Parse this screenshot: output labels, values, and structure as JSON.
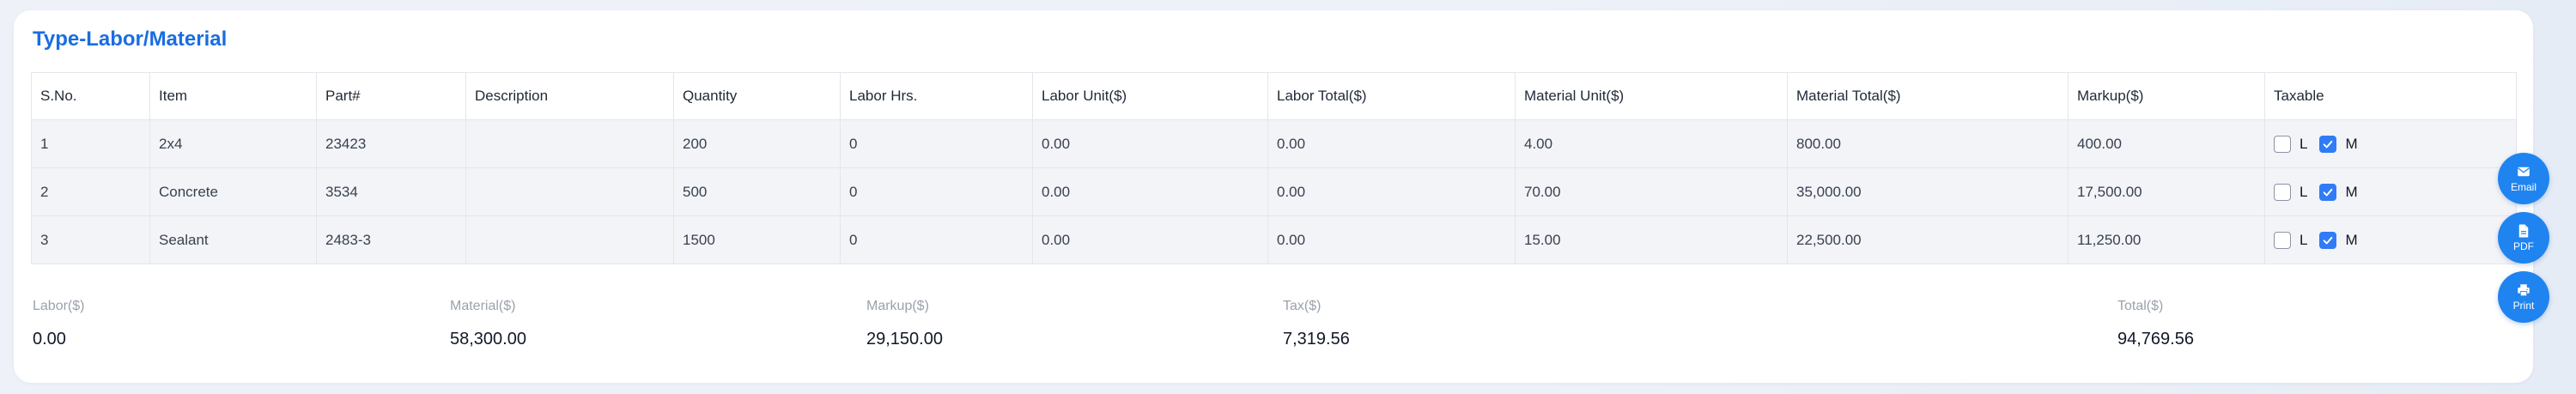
{
  "section_title": "Type-Labor/Material",
  "table": {
    "headers": [
      "S.No.",
      "Item",
      "Part#",
      "Description",
      "Quantity",
      "Labor Hrs.",
      "Labor Unit($)",
      "Labor Total($)",
      "Material Unit($)",
      "Material Total($)",
      "Markup($)",
      "Taxable"
    ],
    "rows": [
      {
        "sno": "1",
        "item": "2x4",
        "part": "23423",
        "description": "",
        "quantity": "200",
        "labor_hrs": "0",
        "labor_unit": "0.00",
        "labor_total": "0.00",
        "material_unit": "4.00",
        "material_total": "800.00",
        "markup": "400.00",
        "taxable_l": false,
        "taxable_m": true
      },
      {
        "sno": "2",
        "item": "Concrete",
        "part": "3534",
        "description": "",
        "quantity": "500",
        "labor_hrs": "0",
        "labor_unit": "0.00",
        "labor_total": "0.00",
        "material_unit": "70.00",
        "material_total": "35,000.00",
        "markup": "17,500.00",
        "taxable_l": false,
        "taxable_m": true
      },
      {
        "sno": "3",
        "item": "Sealant",
        "part": "2483-3",
        "description": "",
        "quantity": "1500",
        "labor_hrs": "0",
        "labor_unit": "0.00",
        "labor_total": "0.00",
        "material_unit": "15.00",
        "material_total": "22,500.00",
        "markup": "11,250.00",
        "taxable_l": false,
        "taxable_m": true
      }
    ],
    "taxable_labels": {
      "l": "L",
      "m": "M"
    }
  },
  "summary": {
    "labor_label": "Labor($)",
    "labor_value": "0.00",
    "material_label": "Material($)",
    "material_value": "58,300.00",
    "markup_label": "Markup($)",
    "markup_value": "29,150.00",
    "tax_label": "Tax($)",
    "tax_value": "7,319.56",
    "total_label": "Total($)",
    "total_value": "94,769.56"
  },
  "actions": {
    "email_label": "Email",
    "pdf_label": "PDF",
    "print_label": "Print"
  },
  "colors": {
    "accent": "#1a6de0",
    "button": "#1f84f0",
    "checkbox_checked": "#2f7cf6",
    "row_bg": "#f3f4f7"
  }
}
